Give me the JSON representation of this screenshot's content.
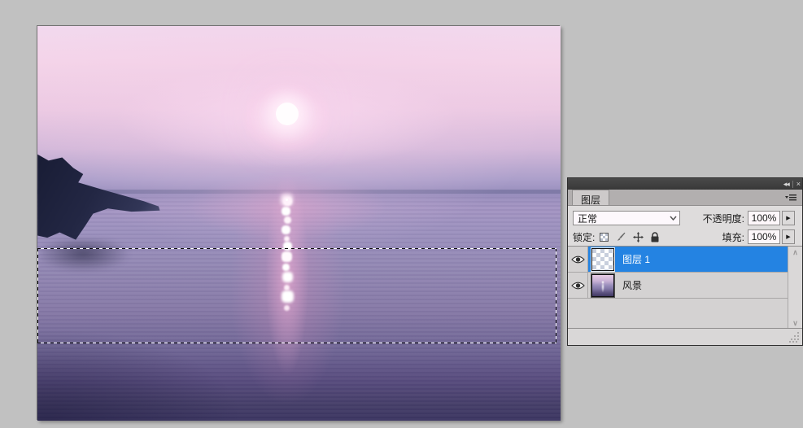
{
  "window": {
    "background_color": "#c1c1c1"
  },
  "canvas": {
    "content": "sunset over lake with marching-ants selection band",
    "selection_visible": true
  },
  "layers_panel": {
    "titlebar": {
      "collapse_label": "◂◂",
      "close_label": "×"
    },
    "tab_label": "图层",
    "blend_mode": {
      "value": "正常"
    },
    "opacity": {
      "label": "不透明度:",
      "value": "100%",
      "spinner": "▶"
    },
    "lock": {
      "label": "锁定:",
      "icons": [
        "lock-transparency",
        "lock-pixels",
        "lock-position",
        "lock-all"
      ]
    },
    "fill": {
      "label": "填充:",
      "value": "100%",
      "spinner": "▶"
    },
    "scrollbar": {
      "up": "∧",
      "down": "∨"
    },
    "layers": [
      {
        "name": "图层 1",
        "selected": true,
        "visible": true,
        "thumbnail": "transparent-checkerboard"
      },
      {
        "name": "风景",
        "selected": false,
        "visible": true,
        "thumbnail": "sunset-photo"
      }
    ],
    "accent_color": "#2483e2"
  }
}
